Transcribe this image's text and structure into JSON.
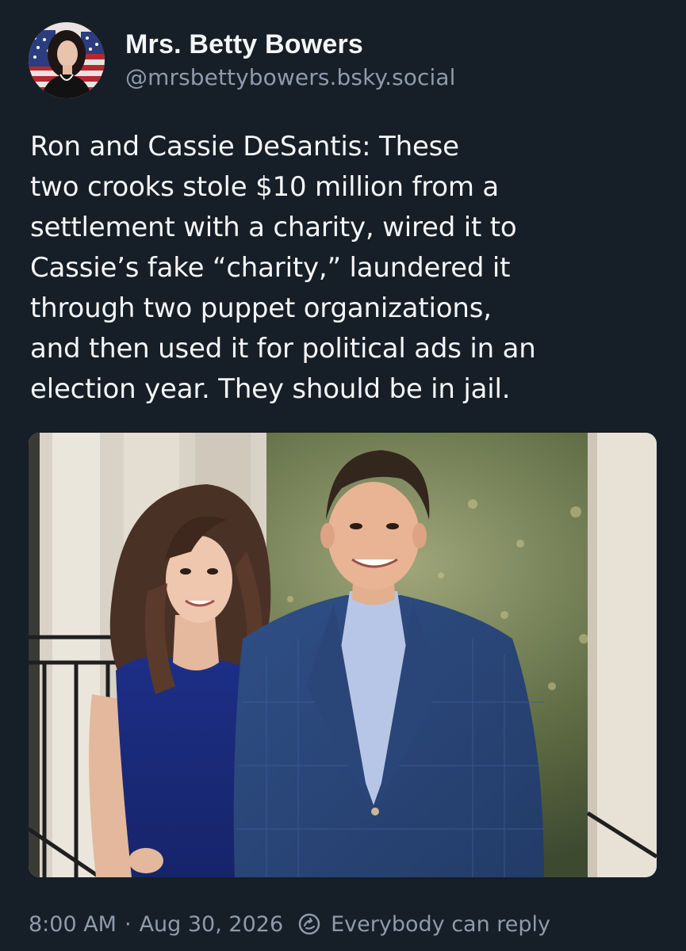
{
  "author": {
    "display_name": "Mrs. Betty Bowers",
    "handle": "@mrsbettybowers.bsky.social",
    "avatar_icon": "portrait-avatar-flag-background"
  },
  "post": {
    "text_lines": [
      "Ron and Cassie DeSantis: These",
      "two crooks stole $10 million from a",
      "settlement with a charity, wired it to",
      "Cassie’s fake “charity,” laundered it",
      "through two puppet organizations,",
      "and then used it for political ads in an",
      "election year. They should be in jail."
    ],
    "image": {
      "description_icon": "couple-photo"
    }
  },
  "footer": {
    "time": "8:00 AM",
    "separator": "·",
    "date": "Aug 30, 2026",
    "reply_icon": "reply-permission-icon",
    "reply_setting": "Everybody can reply"
  },
  "colors": {
    "background": "#161e27",
    "text": "#f4f6f8",
    "muted": "#8e9bab"
  }
}
